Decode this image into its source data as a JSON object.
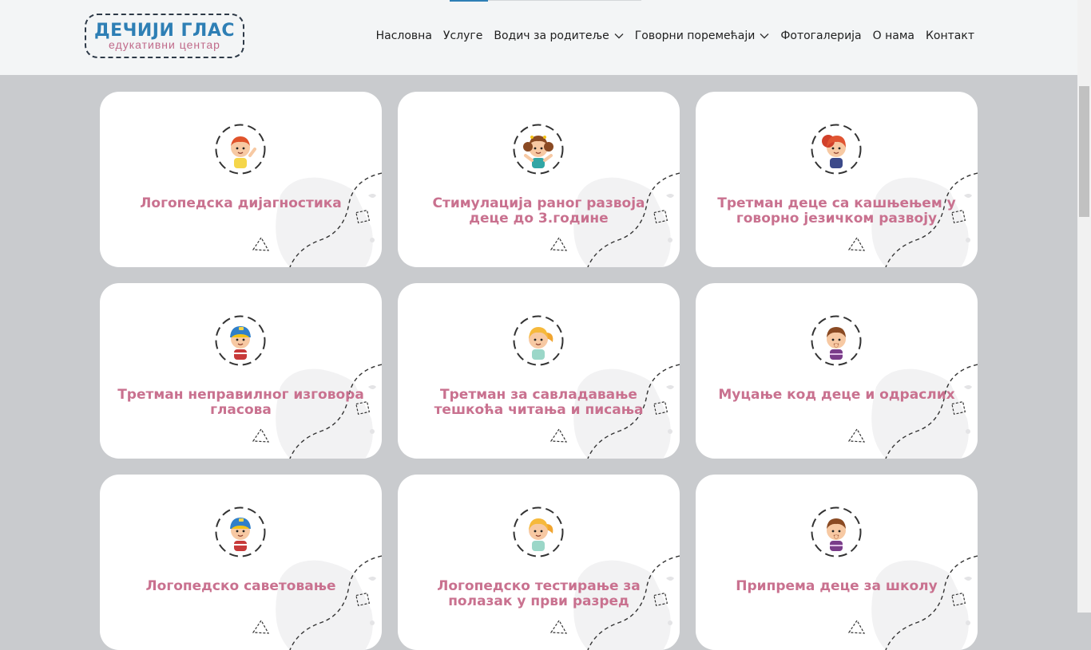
{
  "logo": {
    "title": "ДЕЧИЈИ ГЛАС",
    "subtitle": "едукативни центар"
  },
  "nav": [
    {
      "label": "Насловна",
      "dropdown": false
    },
    {
      "label": "Услуге",
      "dropdown": false
    },
    {
      "label": "Водич за родитеље",
      "dropdown": true
    },
    {
      "label": "Говорни поремећаји",
      "dropdown": true
    },
    {
      "label": "Фотогалерија",
      "dropdown": false
    },
    {
      "label": "О нама",
      "dropdown": false
    },
    {
      "label": "Контакт",
      "dropdown": false
    }
  ],
  "colors": {
    "brand_blue": "#2e7fb5",
    "brand_pink": "#c9718f",
    "page_bg": "#c9cbce",
    "header_bg": "#f3f5f6"
  },
  "services": [
    {
      "title": "Логопедска дијагностика",
      "icon": "boy-waving-icon"
    },
    {
      "title": "Стимулација раног развоја деце до 3.године",
      "icon": "girl-pigtails-icon"
    },
    {
      "title": "Третман деце са кашњењем у говорно језичком развоју",
      "icon": "girl-red-hair-icon"
    },
    {
      "title": "Третман неправилног изговора гласова",
      "icon": "boy-cap-icon"
    },
    {
      "title": "Третман за савладавање тешкоћа читања и писања",
      "icon": "girl-ponytail-icon"
    },
    {
      "title": "Муцање код деце и одраслих",
      "icon": "boy-thinking-icon"
    },
    {
      "title": "Логопедско саветовање",
      "icon": "boy-cap-icon"
    },
    {
      "title": "Логопедско тестирање за полазак у први разред",
      "icon": "girl-ponytail-icon"
    },
    {
      "title": "Припрема деце за школу",
      "icon": "boy-thinking-icon"
    }
  ]
}
